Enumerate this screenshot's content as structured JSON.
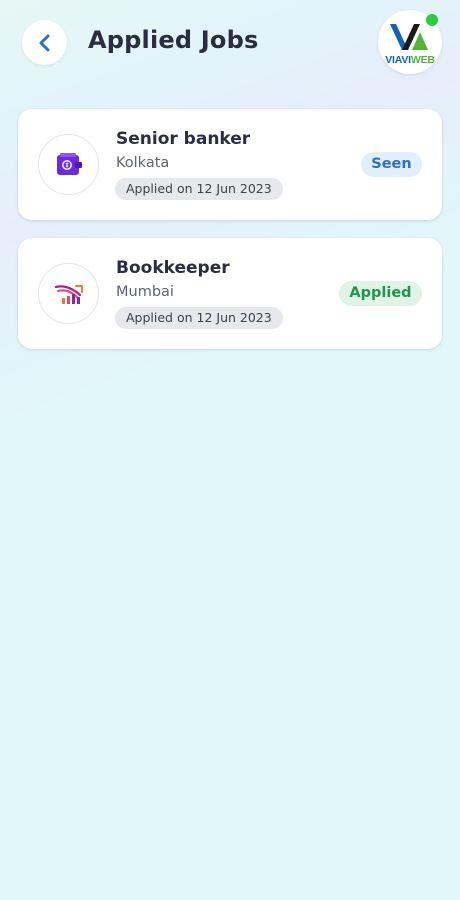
{
  "header": {
    "title": "Applied Jobs",
    "logo_text_a": "VIAVI",
    "logo_text_b": "WEB"
  },
  "jobs": [
    {
      "title": "Senior banker",
      "location": "Kolkata",
      "applied_on": "Applied on 12 Jun 2023",
      "status": "Seen",
      "company_icon": "wallet-icon"
    },
    {
      "title": "Bookkeeper",
      "location": "Mumbai",
      "applied_on": "Applied on 12 Jun 2023",
      "status": "Applied",
      "company_icon": "growth-chart-logo-icon"
    }
  ],
  "colors": {
    "accent_blue": "#2a6fd6",
    "seen_bg": "#e1eefb",
    "applied_green": "#23954a",
    "applied_bg": "#dff3e6",
    "wallet_purple": "#6a2be0",
    "logo_magenta": "#c2187a"
  }
}
